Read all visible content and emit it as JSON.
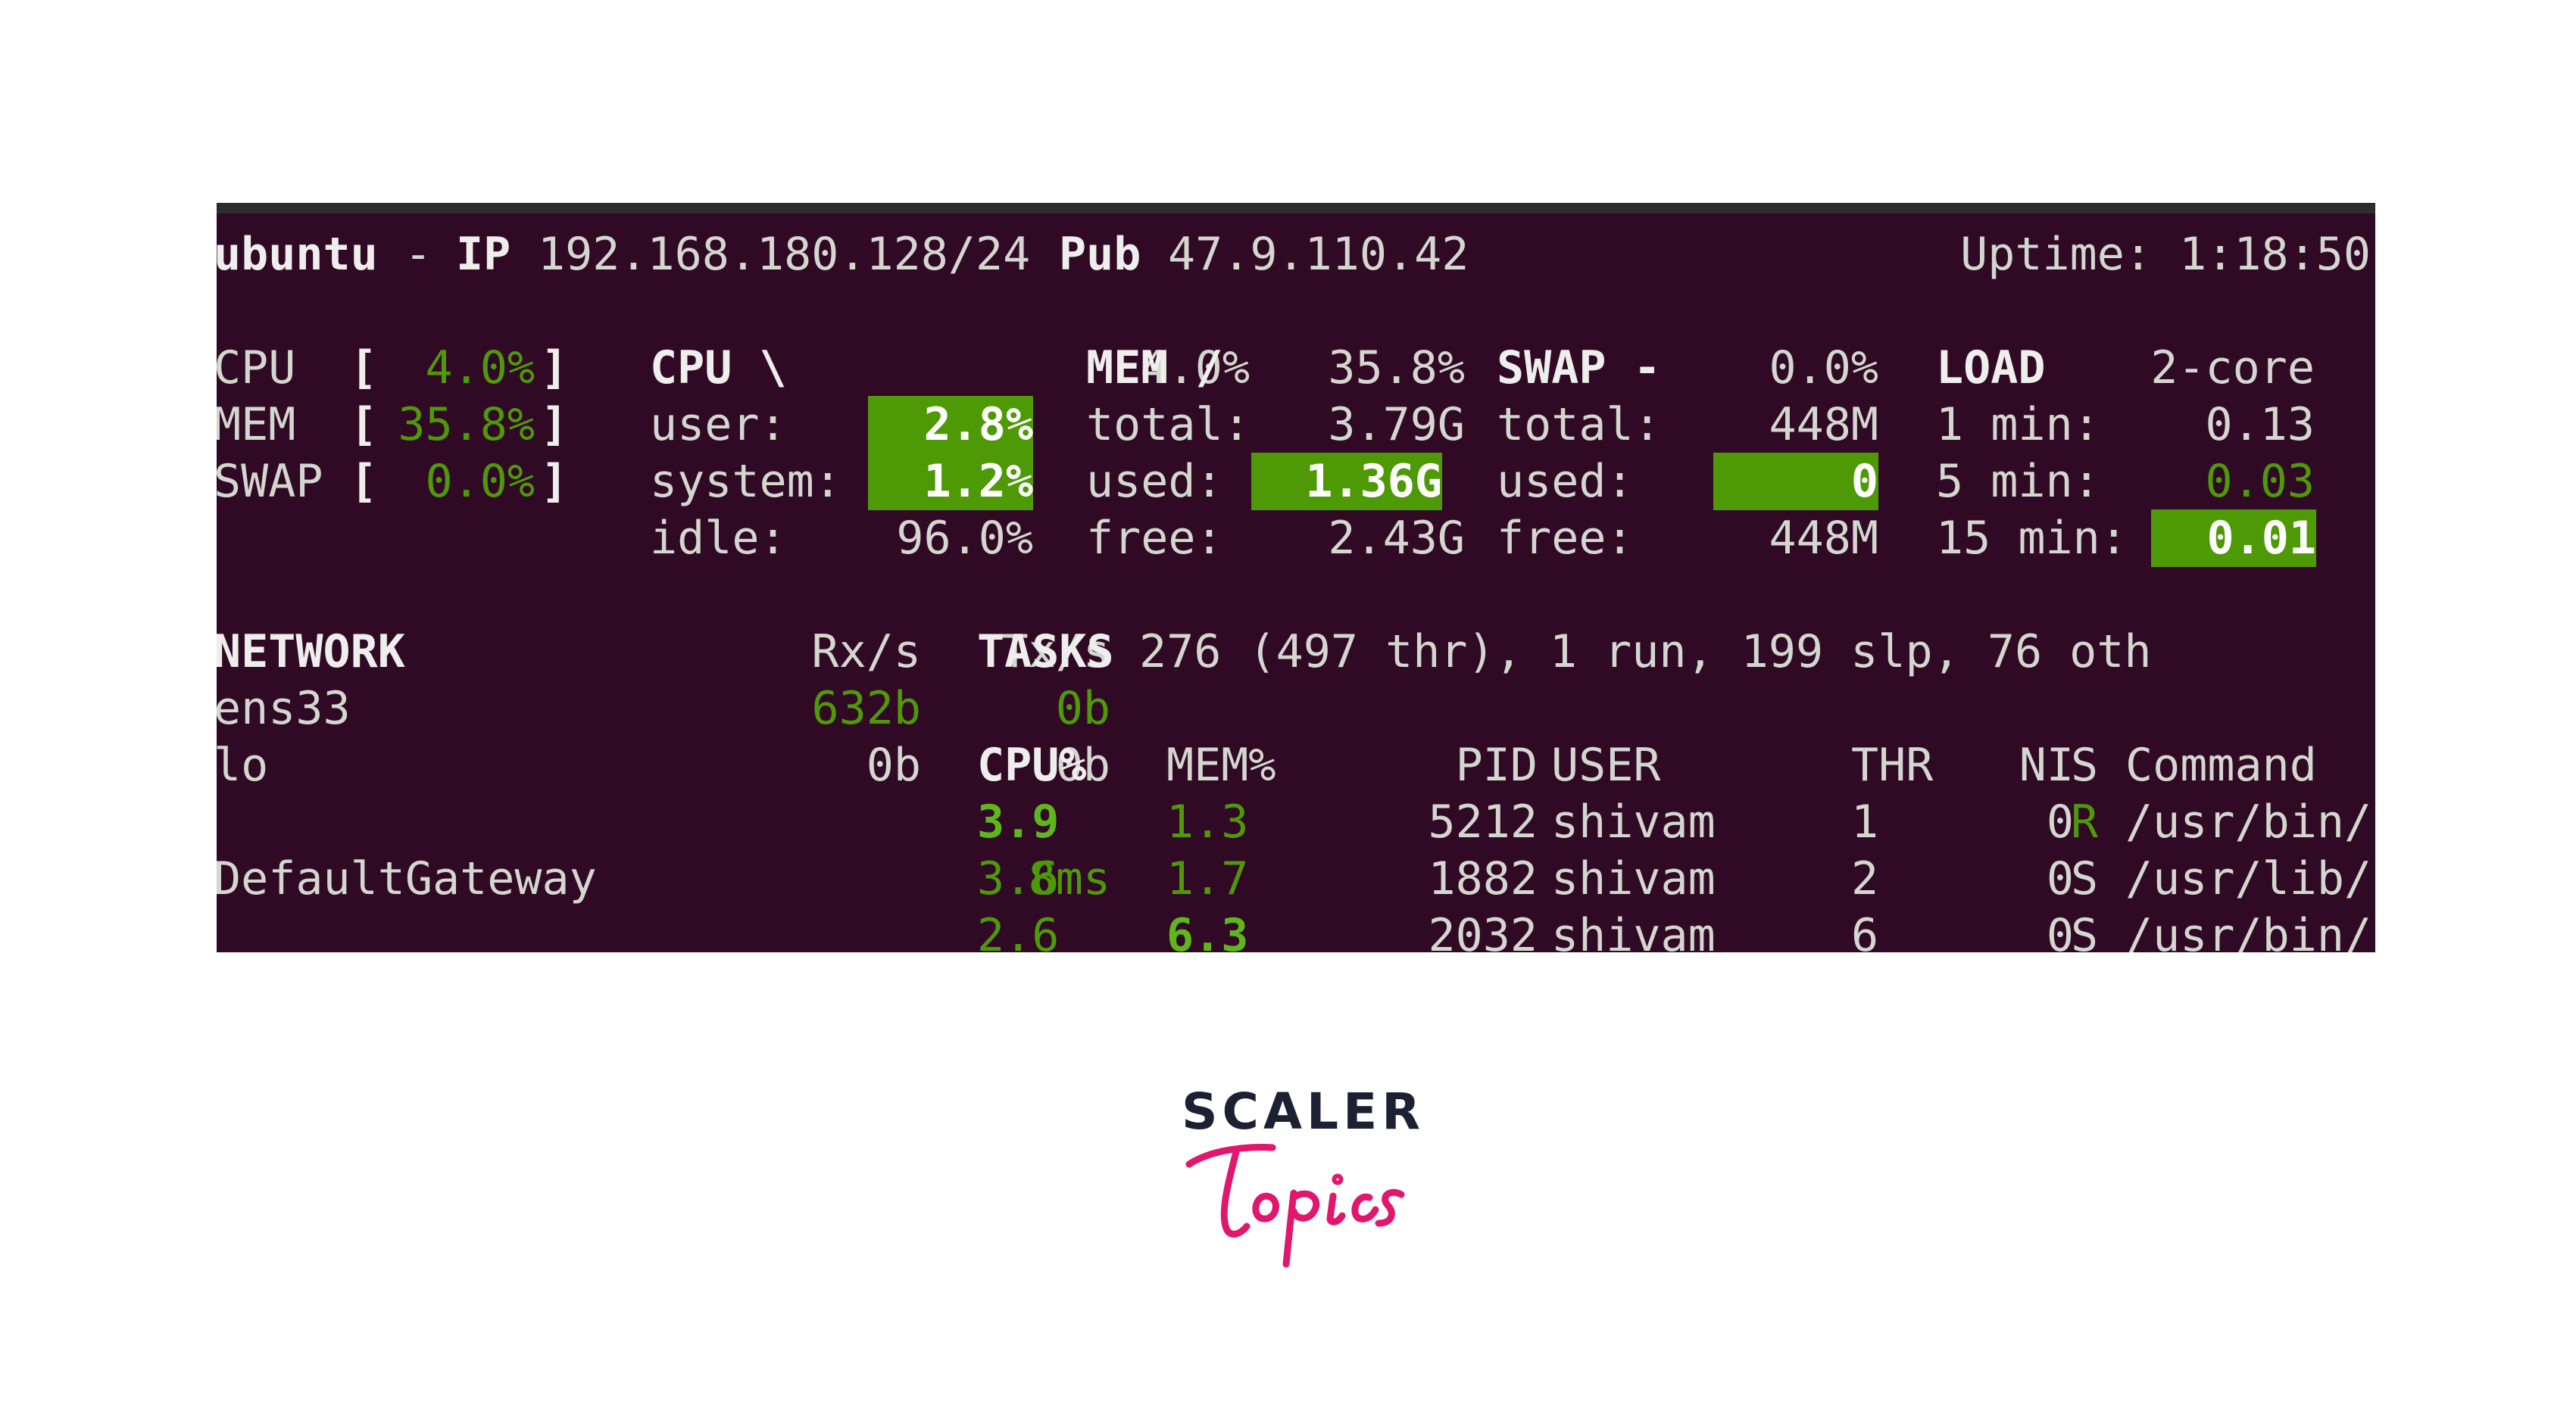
{
  "header": {
    "host": "ubuntu",
    "sep": "-",
    "ip_label": "IP",
    "ip_value": "192.168.180.128/24",
    "pub_label": "Pub",
    "pub_value": "47.9.110.42",
    "uptime": "Uptime: 1:18:50"
  },
  "quicklook": {
    "cpu_label": "CPU",
    "cpu_value": "4.0%",
    "mem_label": "MEM",
    "mem_value": "35.8%",
    "swap_label": "SWAP",
    "swap_value": "0.0%",
    "open": "[",
    "close": "]"
  },
  "cpu": {
    "title": "CPU \\",
    "total": "4.0%",
    "user_label": "user:",
    "user": "2.8%",
    "system_label": "system:",
    "system": "1.2%",
    "idle_label": "idle:",
    "idle": "96.0%"
  },
  "mem": {
    "title": "MEM /",
    "percent": "35.8%",
    "total_label": "total:",
    "total": "3.79G",
    "used_label": "used:",
    "used": "1.36G",
    "free_label": "free:",
    "free": "2.43G"
  },
  "swap": {
    "title": "SWAP -",
    "percent": "0.0%",
    "total_label": "total:",
    "total": "448M",
    "used_label": "used:",
    "used": "0",
    "free_label": "free:",
    "free": "448M"
  },
  "load": {
    "title": "LOAD",
    "cores": "2-core",
    "m1_label": "1 min:",
    "m1": "0.13",
    "m5_label": "5 min:",
    "m5": "0.03",
    "m15_label": "15 min:",
    "m15": "0.01"
  },
  "network": {
    "title": "NETWORK",
    "rx_header": "Rx/s",
    "tx_header": "Tx/s",
    "interfaces": [
      {
        "name": "ens33",
        "rx": "632b",
        "tx": "0b"
      },
      {
        "name": "lo",
        "rx": "0b",
        "tx": "0b"
      }
    ],
    "gateway_label": "DefaultGateway",
    "gateway_value": "8ms"
  },
  "tasks": {
    "title": "TASKS",
    "summary": "276 (497 thr), 1 run, 199 slp, 76 oth"
  },
  "processes": {
    "headers": {
      "cpu": "CPU%",
      "mem": "MEM%",
      "pid": "PID",
      "user": "USER",
      "thr": "THR",
      "ni": "NI",
      "s": "S",
      "cmd": "Command"
    },
    "rows": [
      {
        "cpu": "3.9",
        "mem": "1.3",
        "pid": "5212",
        "user": "shivam",
        "thr": "1",
        "ni": "0",
        "s": "R",
        "cmd": "/usr/bin/"
      },
      {
        "cpu": "3.6",
        "mem": "1.7",
        "pid": "1882",
        "user": "shivam",
        "thr": "2",
        "ni": "0",
        "s": "S",
        "cmd": "/usr/lib/"
      },
      {
        "cpu": "2.6",
        "mem": "6.3",
        "pid": "2032",
        "user": "shivam",
        "thr": "6",
        "ni": "0",
        "s": "S",
        "cmd": "/usr/bin/"
      }
    ]
  },
  "brand": {
    "top": "SCALER",
    "bottom": "Topics",
    "top_color": "#1c2033",
    "bottom_color": "#e0176c"
  },
  "colors": {
    "terminal_bg": "#300a24",
    "accent_green": "#4e9a06",
    "text": "#d3d7cf"
  }
}
